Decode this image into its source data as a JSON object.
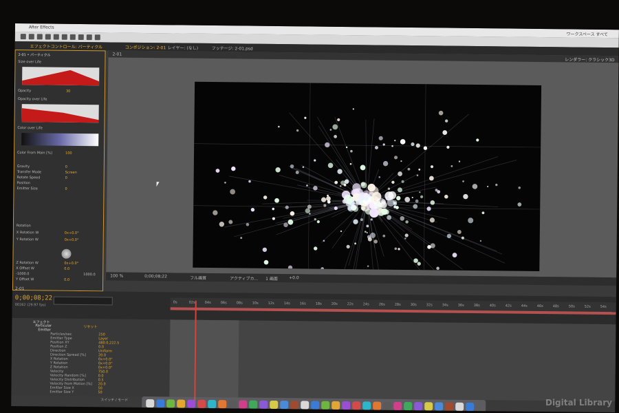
{
  "app": {
    "title": "After Effects",
    "workspace_label": "ワークスペース",
    "workspace_value": "すべて"
  },
  "tabs": {
    "effects": "エフェクトコントロール: パーティクル",
    "composition": "コンポジション: 2-01",
    "layer": "レイヤー: (なし)",
    "footage": "フッテージ: 2-01.psd"
  },
  "viewer": {
    "comp_name": "2-01",
    "renderer_label": "レンダラー:",
    "renderer_value": "クラシック3D",
    "footer": {
      "zoom": "100 %",
      "time": "0;00;08;22",
      "resolution": "フル画質",
      "camera": "アクティブカ...",
      "views": "1 画面",
      "exposure": "+0.0"
    }
  },
  "effects_panel": {
    "header": "2-01 • パーティクル",
    "rows": [
      {
        "label": "Size over Life",
        "value": ""
      },
      {
        "label": "Opacity",
        "value": "30"
      },
      {
        "label": "Opacity over Life",
        "value": ""
      },
      {
        "label": "Color over Life",
        "value": ""
      },
      {
        "label": "Color From Main [%]",
        "value": "100"
      },
      {
        "label": "Gravity",
        "value": "0"
      },
      {
        "label": "Transfer Mode",
        "value": "Screen"
      },
      {
        "label": "Rotate Speed",
        "value": "0"
      },
      {
        "label": "Position",
        "value": ""
      },
      {
        "label": "Emitter Size",
        "value": "0"
      },
      {
        "label": "Rotation",
        "value": ""
      },
      {
        "label": "X Rotation W",
        "value": "0x+0.0°"
      },
      {
        "label": "Y Rotation W",
        "value": "0x+0.0°"
      },
      {
        "label": "Z Rotation W",
        "value": "0x+0.0°"
      },
      {
        "label": "X Offset W",
        "value": "0.0"
      },
      {
        "label": "Y Offset W",
        "value": "0.0"
      }
    ],
    "range_min": "-1000.0",
    "range_max": "1000.0"
  },
  "timeline": {
    "comp_tab": "2-01",
    "timecode": "0;00;08;22",
    "fps_label": "00262 (29.97 fps)",
    "ruler_ticks": [
      "0s",
      "02s",
      "04s",
      "06s",
      "08s",
      "10s",
      "12s",
      "14s",
      "16s",
      "18s",
      "20s",
      "22s",
      "24s",
      "26s",
      "28s",
      "30s",
      "32s",
      "34s",
      "36s",
      "38s",
      "40s",
      "42s",
      "44s",
      "46s",
      "48s",
      "50s",
      "52s",
      "54s"
    ],
    "layers": [
      {
        "label": "エフェクト",
        "value": "",
        "kind": "hdr"
      },
      {
        "label": "Particular",
        "value": "リセット",
        "kind": "hdr"
      },
      {
        "label": "Emitter",
        "value": "",
        "kind": "hdr"
      },
      {
        "label": "Particles/sec",
        "value": "250"
      },
      {
        "label": "Emitter Type",
        "value": "Layer"
      },
      {
        "label": "Position XY",
        "value": "480.0,222.5"
      },
      {
        "label": "Position Z",
        "value": "0.0"
      },
      {
        "label": "Direction",
        "value": "Uniform"
      },
      {
        "label": "Direction Spread [%]",
        "value": "20.0"
      },
      {
        "label": "X Rotation",
        "value": "0x+0.0°"
      },
      {
        "label": "Y Rotation",
        "value": "0x+0.0°"
      },
      {
        "label": "Z Rotation",
        "value": "0x+0.0°"
      },
      {
        "label": "Velocity",
        "value": "750.0"
      },
      {
        "label": "Velocity Random [%]",
        "value": "0.0"
      },
      {
        "label": "Velocity Distribution",
        "value": "0.5"
      },
      {
        "label": "Velocity from Motion [%]",
        "value": "20.0"
      },
      {
        "label": "Emitter Size X",
        "value": "50"
      },
      {
        "label": "Emitter Size Y",
        "value": "50"
      }
    ],
    "footer_label": "スイッチ / モード"
  },
  "watermark": "Digital Library",
  "colors": {
    "accent": "#e0a832",
    "playhead": "#d9413b",
    "panel_border": "#d39a2a",
    "graph_red": "#c41a1a"
  }
}
